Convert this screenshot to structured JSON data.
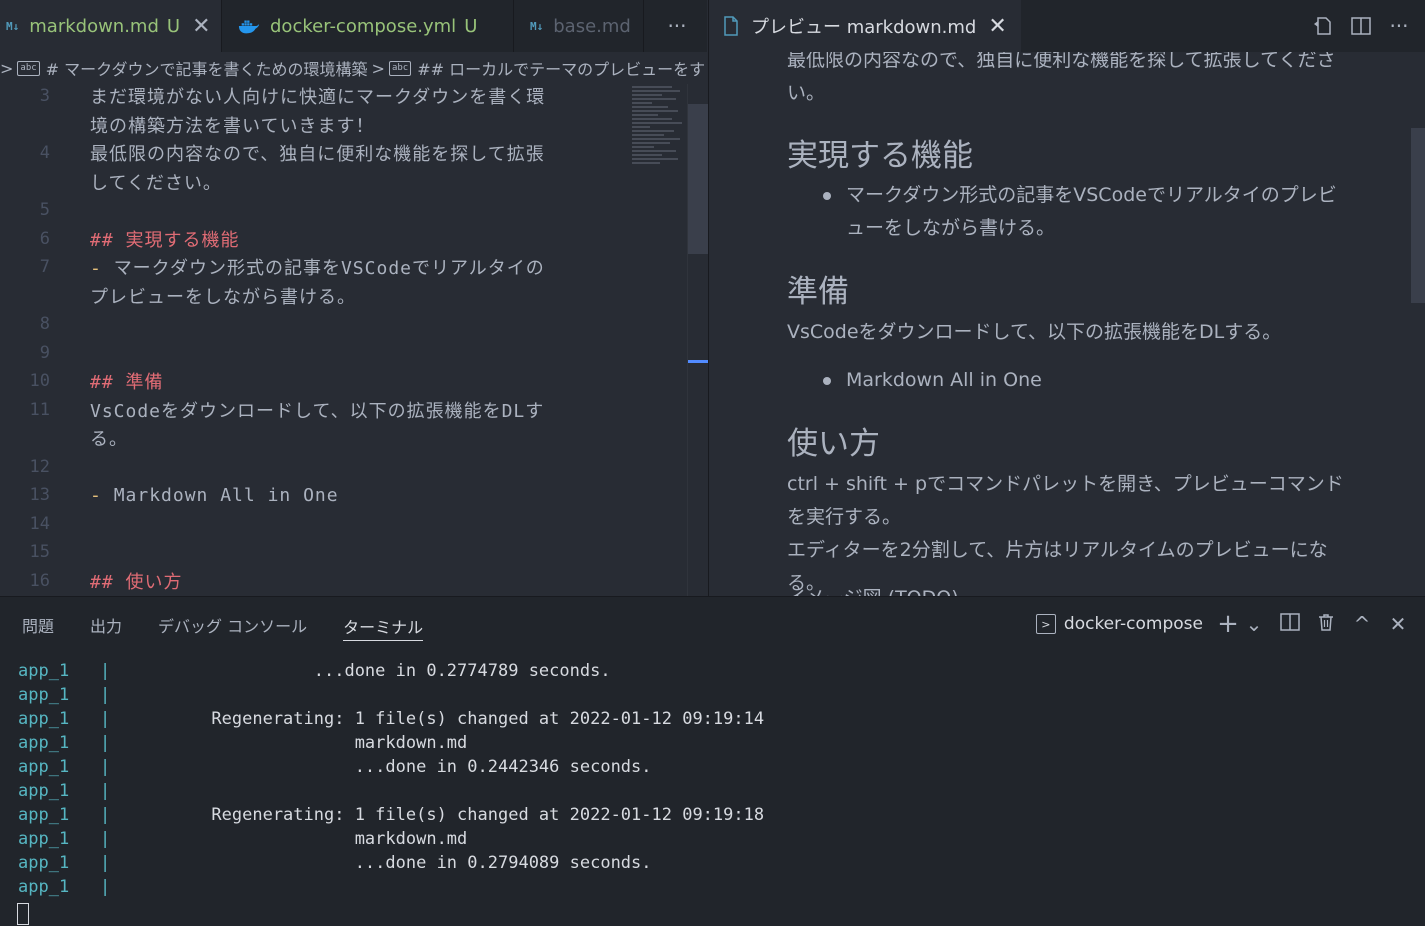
{
  "left_tabs": [
    {
      "icon": "M↓",
      "label": "markdown.md",
      "status": "U",
      "close": "✕"
    },
    {
      "label": "docker-compose.yml",
      "status": "U"
    },
    {
      "icon": "M↓",
      "label": "base.md"
    }
  ],
  "more_label": "···",
  "breadcrumb": {
    "item1": "# マークダウンで記事を書くための環境構築",
    "item2": "## ローカルでテーマのプレビューをする",
    "sep": ">"
  },
  "editor": {
    "lines": [
      {
        "n": "3",
        "text": "まだ環境がない人向けに快適にマークダウンを書く環"
      },
      {
        "n": "",
        "text": "境の構築方法を書いていきます！"
      },
      {
        "n": "4",
        "text": "最低限の内容なので、独自に便利な機能を探して拡張"
      },
      {
        "n": "",
        "text": "してください。"
      },
      {
        "n": "5",
        "text": ""
      },
      {
        "n": "6",
        "mark": "##",
        "text": "実現する機能"
      },
      {
        "n": "7",
        "mark": "-",
        "text": "マークダウン形式の記事をVSCodeでリアルタイの"
      },
      {
        "n": "",
        "text": "プレビューをしながら書ける。"
      },
      {
        "n": "8",
        "text": ""
      },
      {
        "n": "9",
        "text": ""
      },
      {
        "n": "10",
        "mark": "##",
        "text": "準備"
      },
      {
        "n": "11",
        "text": "VsCodeをダウンロードして、以下の拡張機能をDLす"
      },
      {
        "n": "",
        "text": "る。"
      },
      {
        "n": "12",
        "text": ""
      },
      {
        "n": "13",
        "mark": "-",
        "text": "Markdown All in One"
      },
      {
        "n": "14",
        "text": ""
      },
      {
        "n": "15",
        "text": ""
      },
      {
        "n": "16",
        "mark": "##",
        "text": "使い方"
      }
    ]
  },
  "preview_tab": {
    "label": "プレビュー markdown.md",
    "close": "✕"
  },
  "preview": {
    "p1_line1": "最低限の内容なので、独自に便利な機能を探して拡張してくださ",
    "p1_line2": "い。",
    "h_features": "実現する機能",
    "li_features": "マークダウン形式の記事をVSCodeでリアルタイのプレビューをしながら書ける。",
    "h_prep": "準備",
    "p_prep": "VsCodeをダウンロードして、以下の拡張機能をDLする。",
    "li_prep": "Markdown All in One",
    "h_usage": "使い方",
    "p_usage1": "ctrl + shift + pでコマンドパレットを開き、プレビューコマンドを実行する。",
    "p_usage2": "エディターを2分割して、片方はリアルタイムのプレビューになる。",
    "p_cut": "イメージ図 (TODO)"
  },
  "panel": {
    "tabs": [
      "問題",
      "出力",
      "デバッグ コンソール",
      "ターミナル"
    ],
    "terminal_name": "docker-compose",
    "add": "+",
    "chevron": "⌄",
    "maximize": "^",
    "close": "✕"
  },
  "terminal": {
    "lines": [
      {
        "svc": "app_1",
        "pipe": "|",
        "msg": "                ...done in 0.2774789 seconds."
      },
      {
        "svc": "app_1",
        "pipe": "|",
        "msg": ""
      },
      {
        "svc": "app_1",
        "pipe": "|",
        "msg": "      Regenerating: 1 file(s) changed at 2022-01-12 09:19:14"
      },
      {
        "svc": "app_1",
        "pipe": "|",
        "msg": "                    markdown.md"
      },
      {
        "svc": "app_1",
        "pipe": "|",
        "msg": "                    ...done in 0.2442346 seconds."
      },
      {
        "svc": "app_1",
        "pipe": "|",
        "msg": ""
      },
      {
        "svc": "app_1",
        "pipe": "|",
        "msg": "      Regenerating: 1 file(s) changed at 2022-01-12 09:19:18"
      },
      {
        "svc": "app_1",
        "pipe": "|",
        "msg": "                    markdown.md"
      },
      {
        "svc": "app_1",
        "pipe": "|",
        "msg": "                    ...done in 0.2794089 seconds."
      },
      {
        "svc": "app_1",
        "pipe": "|",
        "msg": ""
      }
    ]
  }
}
